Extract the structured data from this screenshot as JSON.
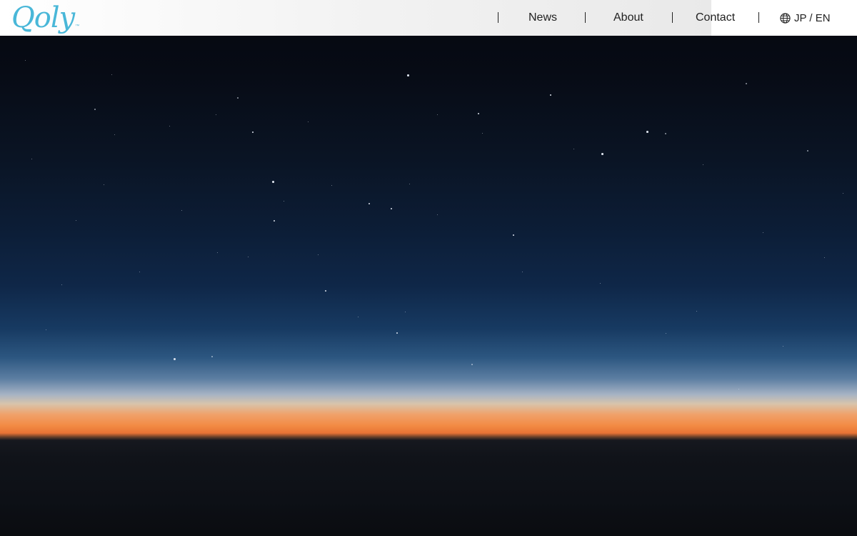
{
  "header": {
    "logo_text": "Qoly",
    "logo_mark": "™",
    "logo_color": "#49b7d8",
    "nav": [
      {
        "label": "News"
      },
      {
        "label": "About"
      },
      {
        "label": "Contact"
      }
    ],
    "language": {
      "icon": "globe-icon",
      "label": "JP / EN"
    }
  },
  "hero": {
    "image": "night-sky-over-cloud-sea-at-dawn"
  }
}
